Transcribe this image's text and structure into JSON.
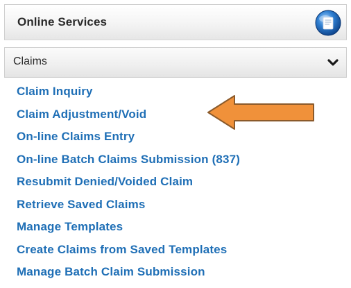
{
  "panel": {
    "title": "Online Services",
    "icon": "globe-icon"
  },
  "section": {
    "title": "Claims",
    "toggle_icon": "chevron-down-icon"
  },
  "links": [
    "Claim Inquiry",
    "Claim Adjustment/Void",
    "On-line Claims Entry",
    "On-line Batch Claims Submission (837)",
    "Resubmit Denied/Voided Claim",
    "Retrieve Saved Claims",
    "Manage Templates",
    "Create Claims from Saved Templates",
    "Manage Batch Claim Submission"
  ],
  "annotation": {
    "icon": "arrow-left-icon",
    "points_to": "Claim Adjustment/Void",
    "color": "#f0913a"
  },
  "colors": {
    "link": "#1f6fb6"
  }
}
